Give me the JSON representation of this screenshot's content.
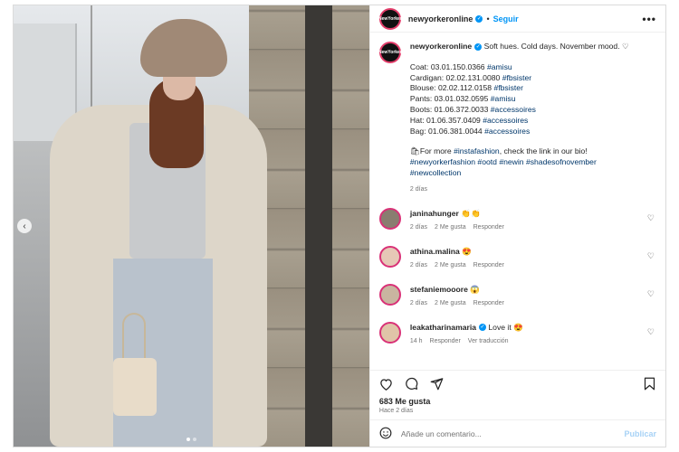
{
  "post": {
    "username": "newyorkeronline",
    "avatar_text": "NewYorker",
    "follow_label": "Seguir",
    "separator": "•",
    "more_label": "•••",
    "caption": {
      "lead": "Soft hues. Cold days. November mood. ♡",
      "items": [
        {
          "text": "Coat: 03.01.150.0366 ",
          "tag": "#amisu"
        },
        {
          "text": "Cardigan: 02.02.131.0080 ",
          "tag": "#fbsister"
        },
        {
          "text": "Blouse: 02.02.112.0158 ",
          "tag": "#fbsister"
        },
        {
          "text": "Pants: 03.01.032.0595 ",
          "tag": "#amisu"
        },
        {
          "text": "Boots: 01.06.372.0033 ",
          "tag": "#accessoires"
        },
        {
          "text": "Hat: 01.06.357.0409 ",
          "tag": "#accessoires"
        },
        {
          "text": "Bag: 01.06.381.0044 ",
          "tag": "#accessoires"
        }
      ],
      "more_prefix": "🛍For more ",
      "more_tag": "#instafashion",
      "more_suffix": ", check the link in our bio!",
      "tags_line1": "#newyorkerfashion #ootd #newin #shadesofnovember",
      "tags_line2": "#newcollection",
      "time": "2 días"
    },
    "comments": [
      {
        "user": "janinahunger",
        "text": "👏👏",
        "time": "2 días",
        "likes": "2 Me gusta",
        "reply": "Responder"
      },
      {
        "user": "athina.malina",
        "text": "😍",
        "time": "2 días",
        "likes": "2 Me gusta",
        "reply": "Responder"
      },
      {
        "user": "stefaniemooore",
        "text": "😱",
        "time": "2 días",
        "likes": "2 Me gusta",
        "reply": "Responder"
      },
      {
        "user": "leakatharinamaria",
        "text": "Love it 😍",
        "time": "14 h",
        "likes": "Responder",
        "reply": "Ver traducción"
      }
    ],
    "likes_count": "683 Me gusta",
    "posted_ago": "Hace 2 días",
    "comment_placeholder": "Añade un comentario...",
    "publish_label": "Publicar",
    "carousel": {
      "total": 2,
      "active": 1
    }
  }
}
